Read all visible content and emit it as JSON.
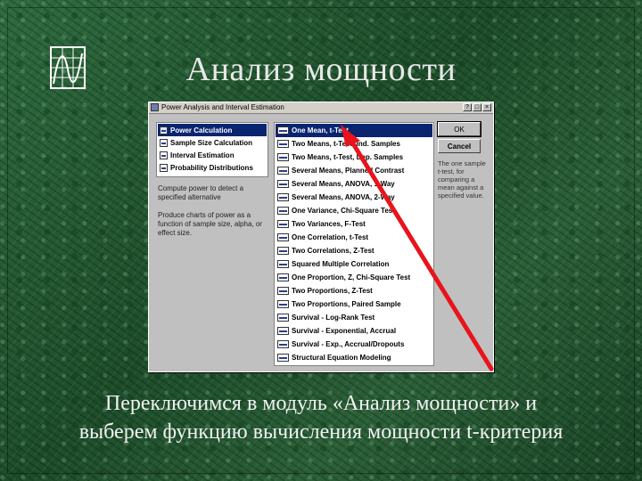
{
  "slide": {
    "title": "Анализ мощности",
    "caption_line1": "Переключимся в модуль «Анализ мощности» и",
    "caption_line2": "выберем функцию вычисления мощности t-критерия"
  },
  "dialog": {
    "title": "Power Analysis and Interval Estimation",
    "title_buttons": [
      "?",
      "□",
      "×"
    ],
    "left_items": [
      {
        "label": "Power Calculation",
        "selected": true
      },
      {
        "label": "Sample Size Calculation",
        "selected": false
      },
      {
        "label": "Interval Estimation",
        "selected": false
      },
      {
        "label": "Probability Distributions",
        "selected": false
      }
    ],
    "desc1": "Compute power to detect a specified alternative",
    "desc2": "Produce charts of power as a function of sample size, alpha, or effect size.",
    "tests": [
      {
        "label": "One Mean, t-Test",
        "selected": true
      },
      {
        "label": "Two Means, t-Test, Ind. Samples",
        "selected": false
      },
      {
        "label": "Two Means, t-Test, Dep. Samples",
        "selected": false
      },
      {
        "label": "Several Means, Planned Contrast",
        "selected": false
      },
      {
        "label": "Several Means, ANOVA, 1-Way",
        "selected": false
      },
      {
        "label": "Several Means, ANOVA, 2-Way",
        "selected": false
      },
      {
        "label": "One Variance, Chi-Square Test",
        "selected": false
      },
      {
        "label": "Two Variances, F-Test",
        "selected": false
      },
      {
        "label": "One Correlation, t-Test",
        "selected": false
      },
      {
        "label": "Two Correlations, Z-Test",
        "selected": false
      },
      {
        "label": "Squared Multiple Correlation",
        "selected": false
      },
      {
        "label": "One Proportion, Z, Chi-Square Test",
        "selected": false
      },
      {
        "label": "Two Proportions, Z-Test",
        "selected": false
      },
      {
        "label": "Two Proportions, Paired Sample",
        "selected": false
      },
      {
        "label": "Survival - Log-Rank Test",
        "selected": false
      },
      {
        "label": "Survival - Exponential, Accrual",
        "selected": false
      },
      {
        "label": "Survival - Exp., Accrual/Dropouts",
        "selected": false
      },
      {
        "label": "Structural Equation Modeling",
        "selected": false
      }
    ],
    "ok_label": "OK",
    "cancel_label": "Cancel",
    "help_text": "The one sample t-test, for comparing a mean against a specified value."
  },
  "colors": {
    "selection": "#0a2470",
    "arrow": "#e8141c"
  }
}
